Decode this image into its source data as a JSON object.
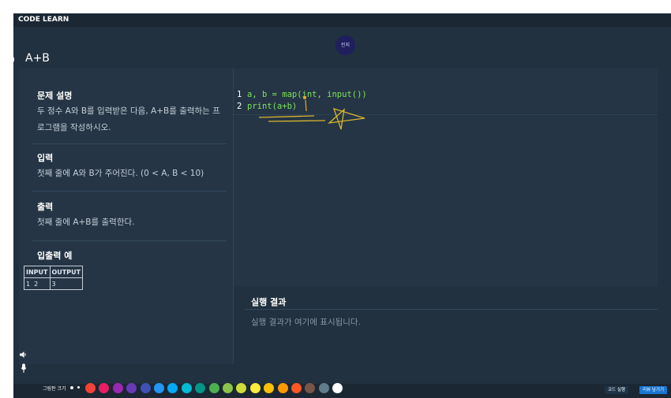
{
  "app": {
    "title": "CODE LEARN"
  },
  "avatar": {
    "name": "린지"
  },
  "problem": {
    "title": "A+B",
    "sections": [
      {
        "heading": "문제 설명",
        "body": [
          "두 정수 A와 B를 입력받은 다음, A+B를 출력하는 프",
          "로그램을 작성하시오."
        ]
      },
      {
        "heading": "입력",
        "body": [
          "첫째 줄에 A와 B가 주어진다. (0 < A, B < 10)"
        ]
      },
      {
        "heading": "출력",
        "body": [
          "첫째 줄에 A+B를 출력한다."
        ]
      },
      {
        "heading": "입출력 예"
      }
    ],
    "io_table": {
      "headers": [
        "INPUT",
        "OUTPUT"
      ],
      "rows": [
        [
          "1  2",
          "3"
        ]
      ]
    }
  },
  "editor": {
    "lines": [
      {
        "number": "1",
        "code": "a, b = map(int, input())"
      },
      {
        "number": "2",
        "code": "print(a+b)"
      }
    ]
  },
  "result": {
    "heading": "실행 결과",
    "placeholder": "실행 결과가 여기에 표시됩니다."
  },
  "toolbar": {
    "pen_label": "그림판 크기",
    "colors": [
      "#f44336",
      "#e91e63",
      "#9c27b0",
      "#673ab7",
      "#3f51b5",
      "#2196f3",
      "#03a9f4",
      "#00bcd4",
      "#009688",
      "#4caf50",
      "#8bc34a",
      "#cddc39",
      "#ffeb3b",
      "#ffc107",
      "#ff9800",
      "#ff5722",
      "#795548",
      "#607d8b",
      "#ffffff"
    ],
    "run_button": "코드 실행",
    "review_button": "리뷰 남기기",
    "run_color": "#1d3347",
    "review_color": "#1976d2"
  },
  "icons": {
    "info": "info-icon",
    "speaker": "speaker-icon",
    "mic": "microphone-icon"
  }
}
